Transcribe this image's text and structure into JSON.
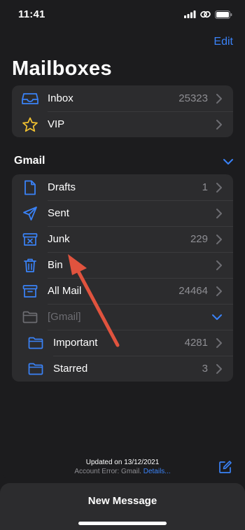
{
  "status_bar": {
    "time": "11:41"
  },
  "header": {
    "edit_label": "Edit",
    "title": "Mailboxes"
  },
  "main_group": [
    {
      "label": "Inbox",
      "count": "25323",
      "icon": "inbox-icon"
    },
    {
      "label": "VIP",
      "count": "",
      "icon": "star-icon"
    }
  ],
  "gmail": {
    "section_title": "Gmail",
    "items": [
      {
        "label": "Drafts",
        "count": "1",
        "icon": "document-icon"
      },
      {
        "label": "Sent",
        "count": "",
        "icon": "paper-plane-icon"
      },
      {
        "label": "Junk",
        "count": "229",
        "icon": "junk-icon"
      },
      {
        "label": "Bin",
        "count": "",
        "icon": "trash-icon"
      },
      {
        "label": "All Mail",
        "count": "24464",
        "icon": "archive-icon"
      },
      {
        "label": "[Gmail]",
        "count": "",
        "icon": "folder-icon"
      },
      {
        "label": "Important",
        "count": "4281",
        "icon": "folder-icon"
      },
      {
        "label": "Starred",
        "count": "3",
        "icon": "folder-icon"
      }
    ]
  },
  "footer": {
    "updated": "Updated on 13/12/2021",
    "account_error": "Account Error: Gmail.",
    "details_link": "Details..."
  },
  "bottom_sheet": {
    "new_message_label": "New Message"
  },
  "colors": {
    "accent": "#3a82f7",
    "background": "#1c1c1e",
    "cell": "#2c2c2e",
    "annotation_arrow": "#e0533e",
    "star": "#f2c230"
  }
}
